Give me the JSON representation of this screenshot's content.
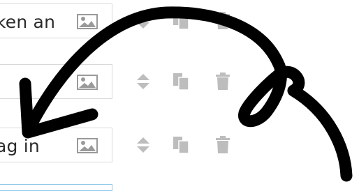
{
  "rows": [
    {
      "text": "ken an",
      "image_icon": "image-icon",
      "actions": [
        "sort-icon",
        "copy-icon",
        "trash-icon"
      ]
    },
    {
      "text": "",
      "image_icon": "image-icon",
      "actions": [
        "sort-icon",
        "copy-icon",
        "trash-icon"
      ]
    },
    {
      "text": "ag in",
      "image_icon": "image-icon",
      "actions": [
        "sort-icon",
        "copy-icon",
        "trash-icon"
      ]
    },
    {
      "text": "",
      "active": true
    }
  ],
  "colors": {
    "icon_gray": "#bdbdbd",
    "field_border": "#d9d9d9",
    "active_border": "#8cc6ea",
    "scribble": "#000000"
  }
}
